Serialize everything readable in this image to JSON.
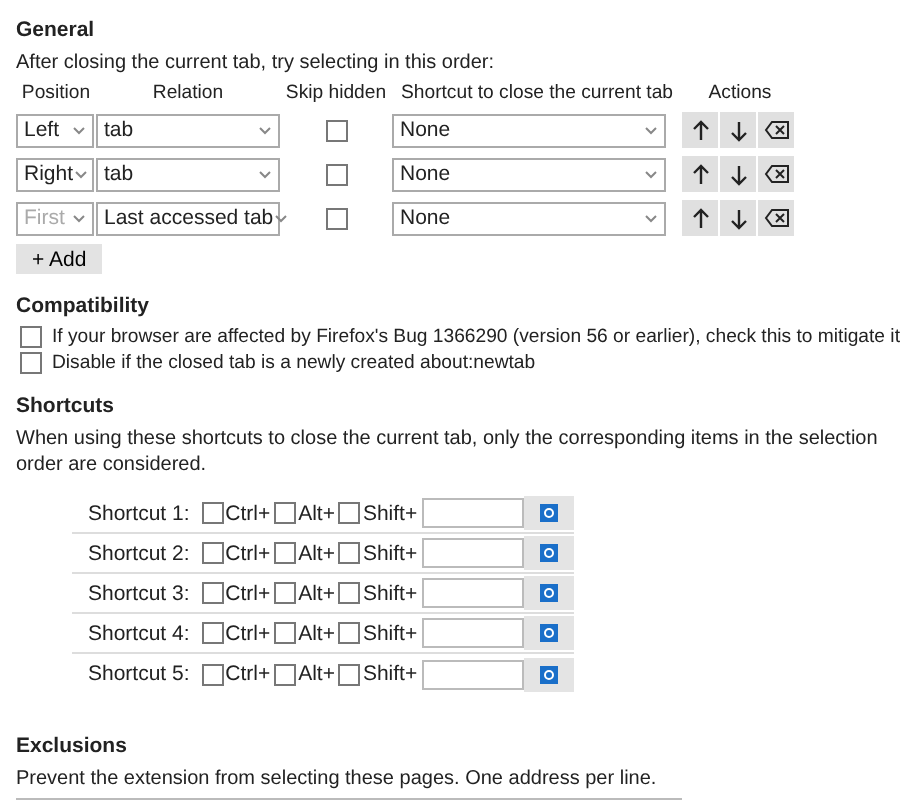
{
  "general": {
    "title": "General",
    "intro": "After closing the current tab, try selecting in this order:",
    "columns": [
      "Position",
      "Relation",
      "Skip hidden",
      "Shortcut to close the current tab",
      "Actions"
    ],
    "rows": [
      {
        "position": "Left",
        "position_disabled": false,
        "relation": "tab",
        "skip_hidden": false,
        "shortcut": "None"
      },
      {
        "position": "Right",
        "position_disabled": false,
        "relation": "tab",
        "skip_hidden": false,
        "shortcut": "None"
      },
      {
        "position": "First",
        "position_disabled": true,
        "relation": "Last accessed tab",
        "skip_hidden": false,
        "shortcut": "None"
      }
    ],
    "add_button": "+ Add"
  },
  "compatibility": {
    "title": "Compatibility",
    "options": [
      {
        "label": "If your browser are affected by Firefox's Bug 1366290 (version 56 or earlier), check this to mitigate it",
        "checked": false
      },
      {
        "label": "Disable if the closed tab is a newly created about:newtab",
        "checked": false
      }
    ]
  },
  "shortcuts": {
    "title": "Shortcuts",
    "description": "When using these shortcuts to close the current tab, only the corresponding items in the selection order are considered.",
    "rows": [
      {
        "label": "Shortcut 1:",
        "ctrl": false,
        "alt": false,
        "shift": false,
        "modifier_labels": [
          "Ctrl+",
          "Alt+",
          "Shift+"
        ]
      },
      {
        "label": "Shortcut 2:",
        "ctrl": false,
        "alt": false,
        "shift": false,
        "modifier_labels": [
          "Ctrl+",
          "Alt+",
          "Shift+"
        ]
      },
      {
        "label": "Shortcut 3:",
        "ctrl": false,
        "alt": false,
        "shift": false,
        "modifier_labels": [
          "Ctrl+",
          "Alt+",
          "Shift+"
        ]
      },
      {
        "label": "Shortcut 4:",
        "ctrl": false,
        "alt": false,
        "shift": false,
        "modifier_labels": [
          "Ctrl+",
          "Alt+",
          "Shift+"
        ]
      },
      {
        "label": "Shortcut 5:",
        "ctrl": false,
        "alt": false,
        "shift": false,
        "modifier_labels": [
          "Ctrl+",
          "Alt+",
          "Shift+"
        ]
      }
    ]
  },
  "exclusions": {
    "title": "Exclusions",
    "description": "Prevent the extension from selecting these pages. One address per line."
  }
}
